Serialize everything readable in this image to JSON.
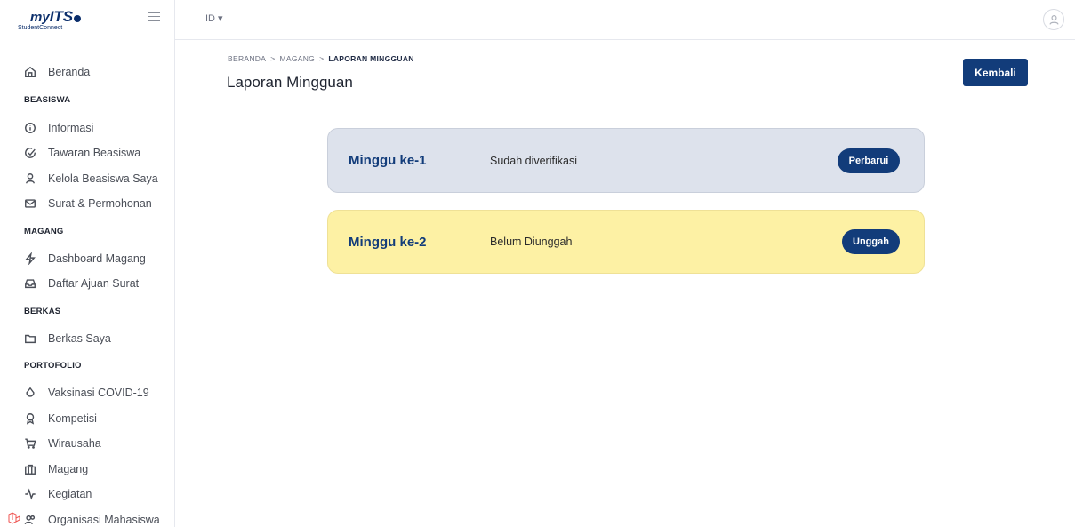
{
  "logo": {
    "main_my": "my",
    "main_its": "ITS",
    "sub": "StudentConnect"
  },
  "topbar": {
    "language": "ID ▾"
  },
  "sidebar": {
    "items": [
      {
        "type": "item",
        "label": "Beranda",
        "icon": "home-icon"
      },
      {
        "type": "section",
        "label": "BEASISWA"
      },
      {
        "type": "item",
        "label": "Informasi",
        "icon": "info-icon"
      },
      {
        "type": "item",
        "label": "Tawaran Beasiswa",
        "icon": "check-circle-icon"
      },
      {
        "type": "item",
        "label": "Kelola Beasiswa Saya",
        "icon": "user-icon"
      },
      {
        "type": "item",
        "label": "Surat & Permohonan",
        "icon": "mail-icon"
      },
      {
        "type": "section",
        "label": "MAGANG"
      },
      {
        "type": "item",
        "label": "Dashboard Magang",
        "icon": "zap-icon"
      },
      {
        "type": "item",
        "label": "Daftar Ajuan Surat",
        "icon": "inbox-icon"
      },
      {
        "type": "section",
        "label": "BERKAS"
      },
      {
        "type": "item",
        "label": "Berkas Saya",
        "icon": "folder-icon"
      },
      {
        "type": "section",
        "label": "PORTOFOLIO"
      },
      {
        "type": "item",
        "label": "Vaksinasi COVID-19",
        "icon": "droplet-icon"
      },
      {
        "type": "item",
        "label": "Kompetisi",
        "icon": "award-icon"
      },
      {
        "type": "item",
        "label": "Wirausaha",
        "icon": "cart-icon"
      },
      {
        "type": "item",
        "label": "Magang",
        "icon": "building-icon"
      },
      {
        "type": "item",
        "label": "Kegiatan",
        "icon": "activity-icon"
      },
      {
        "type": "item",
        "label": "Organisasi Mahasiswa",
        "icon": "users-icon"
      }
    ]
  },
  "breadcrumb": {
    "items": [
      "BERANDA",
      "MAGANG"
    ],
    "current": "LAPORAN MINGGUAN",
    "separator": ">"
  },
  "page": {
    "title": "Laporan Mingguan",
    "back_label": "Kembali"
  },
  "reports": [
    {
      "week": "Minggu ke-1",
      "status": "Sudah diverifikasi",
      "action": "Perbarui",
      "bg": "#dde2ec"
    },
    {
      "week": "Minggu ke-2",
      "status": "Belum Diunggah",
      "action": "Unggah",
      "bg": "#fdf1a4"
    }
  ],
  "colors": {
    "primary": "#123c7a",
    "verified": "#dde2ec",
    "pending": "#fdf1a4"
  }
}
